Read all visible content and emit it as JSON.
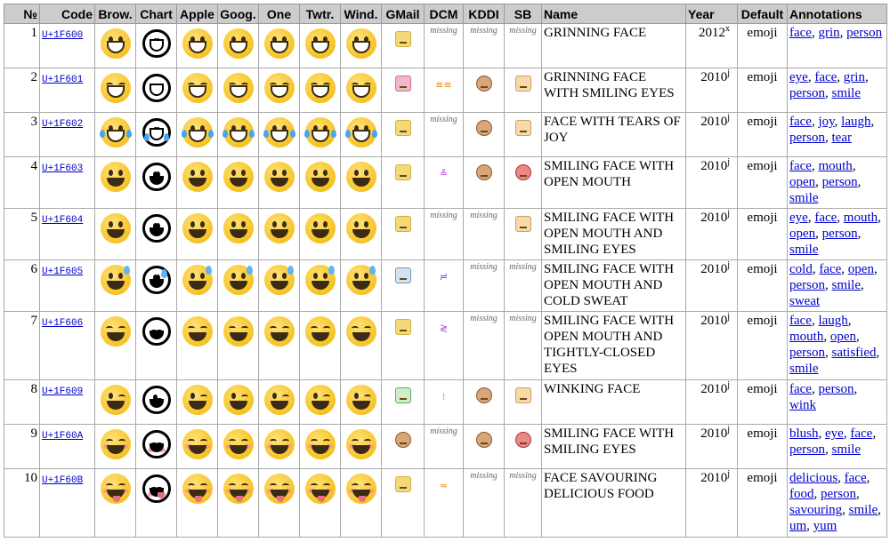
{
  "headers": [
    "№",
    "Code",
    "Brow.",
    "Chart",
    "Apple",
    "Goog.",
    "One",
    "Twtr.",
    "Wind.",
    "GMail",
    "DCM",
    "KDDI",
    "SB",
    "Name",
    "Year",
    "Default",
    "Annotations"
  ],
  "missing_label": "missing",
  "rows": [
    {
      "num": "1",
      "code": "U+1F600",
      "name": "GRINNING FACE",
      "year": "2012",
      "year_sup": "x",
      "default": "emoji",
      "annotations": [
        "face",
        "grin",
        "person"
      ],
      "dcm": null,
      "kddi": null,
      "sb": null
    },
    {
      "num": "2",
      "code": "U+1F601",
      "name": "GRINNING FACE WITH SMILING EYES",
      "year": "2010",
      "year_sup": "j",
      "default": "emoji",
      "annotations": [
        "eye",
        "face",
        "grin",
        "person",
        "smile"
      ],
      "dcm": "≡≡",
      "kddi": "k",
      "sb": "s"
    },
    {
      "num": "3",
      "code": "U+1F602",
      "name": "FACE WITH TEARS OF JOY",
      "year": "2010",
      "year_sup": "j",
      "default": "emoji",
      "annotations": [
        "face",
        "joy",
        "laugh",
        "person",
        "tear"
      ],
      "dcm": null,
      "kddi": "k",
      "sb": "s"
    },
    {
      "num": "4",
      "code": "U+1F603",
      "name": "SMILING FACE WITH OPEN MOUTH",
      "year": "2010",
      "year_sup": "j",
      "default": "emoji",
      "annotations": [
        "face",
        "mouth",
        "open",
        "person",
        "smile"
      ],
      "dcm": "≚",
      "kddi": "k",
      "sb": "r"
    },
    {
      "num": "5",
      "code": "U+1F604",
      "name": "SMILING FACE WITH OPEN MOUTH AND SMILING EYES",
      "year": "2010",
      "year_sup": "j",
      "default": "emoji",
      "annotations": [
        "eye",
        "face",
        "mouth",
        "open",
        "person",
        "smile"
      ],
      "dcm": null,
      "kddi": null,
      "sb": "s"
    },
    {
      "num": "6",
      "code": "U+1F605",
      "name": "SMILING FACE WITH OPEN MOUTH AND COLD SWEAT",
      "year": "2010",
      "year_sup": "j",
      "default": "emoji",
      "annotations": [
        "cold",
        "face",
        "open",
        "person",
        "smile",
        "sweat"
      ],
      "dcm": "≓",
      "kddi": null,
      "sb": null
    },
    {
      "num": "7",
      "code": "U+1F606",
      "name": "SMILING FACE WITH OPEN MOUTH AND TIGHTLY-CLOSED EYES",
      "year": "2010",
      "year_sup": "j",
      "default": "emoji",
      "annotations": [
        "face",
        "laugh",
        "mouth",
        "open",
        "person",
        "satisfied",
        "smile"
      ],
      "dcm": "≷",
      "kddi": null,
      "sb": null
    },
    {
      "num": "8",
      "code": "U+1F609",
      "name": "WINKING FACE",
      "year": "2010",
      "year_sup": "j",
      "default": "emoji",
      "annotations": [
        "face",
        "person",
        "wink"
      ],
      "dcm": "⁝",
      "kddi": "k",
      "sb": "s"
    },
    {
      "num": "9",
      "code": "U+1F60A",
      "name": "SMILING FACE WITH SMILING EYES",
      "year": "2010",
      "year_sup": "j",
      "default": "emoji",
      "annotations": [
        "blush",
        "eye",
        "face",
        "person",
        "smile"
      ],
      "dcm": null,
      "kddi": "k",
      "sb": "r"
    },
    {
      "num": "10",
      "code": "U+1F60B",
      "name": "FACE SAVOURING DELICIOUS FOOD",
      "year": "2010",
      "year_sup": "j",
      "default": "emoji",
      "annotations": [
        "delicious",
        "face",
        "food",
        "person",
        "savouring",
        "smile",
        "um",
        "yum"
      ],
      "dcm": "≈",
      "kddi": null,
      "sb": null
    }
  ]
}
